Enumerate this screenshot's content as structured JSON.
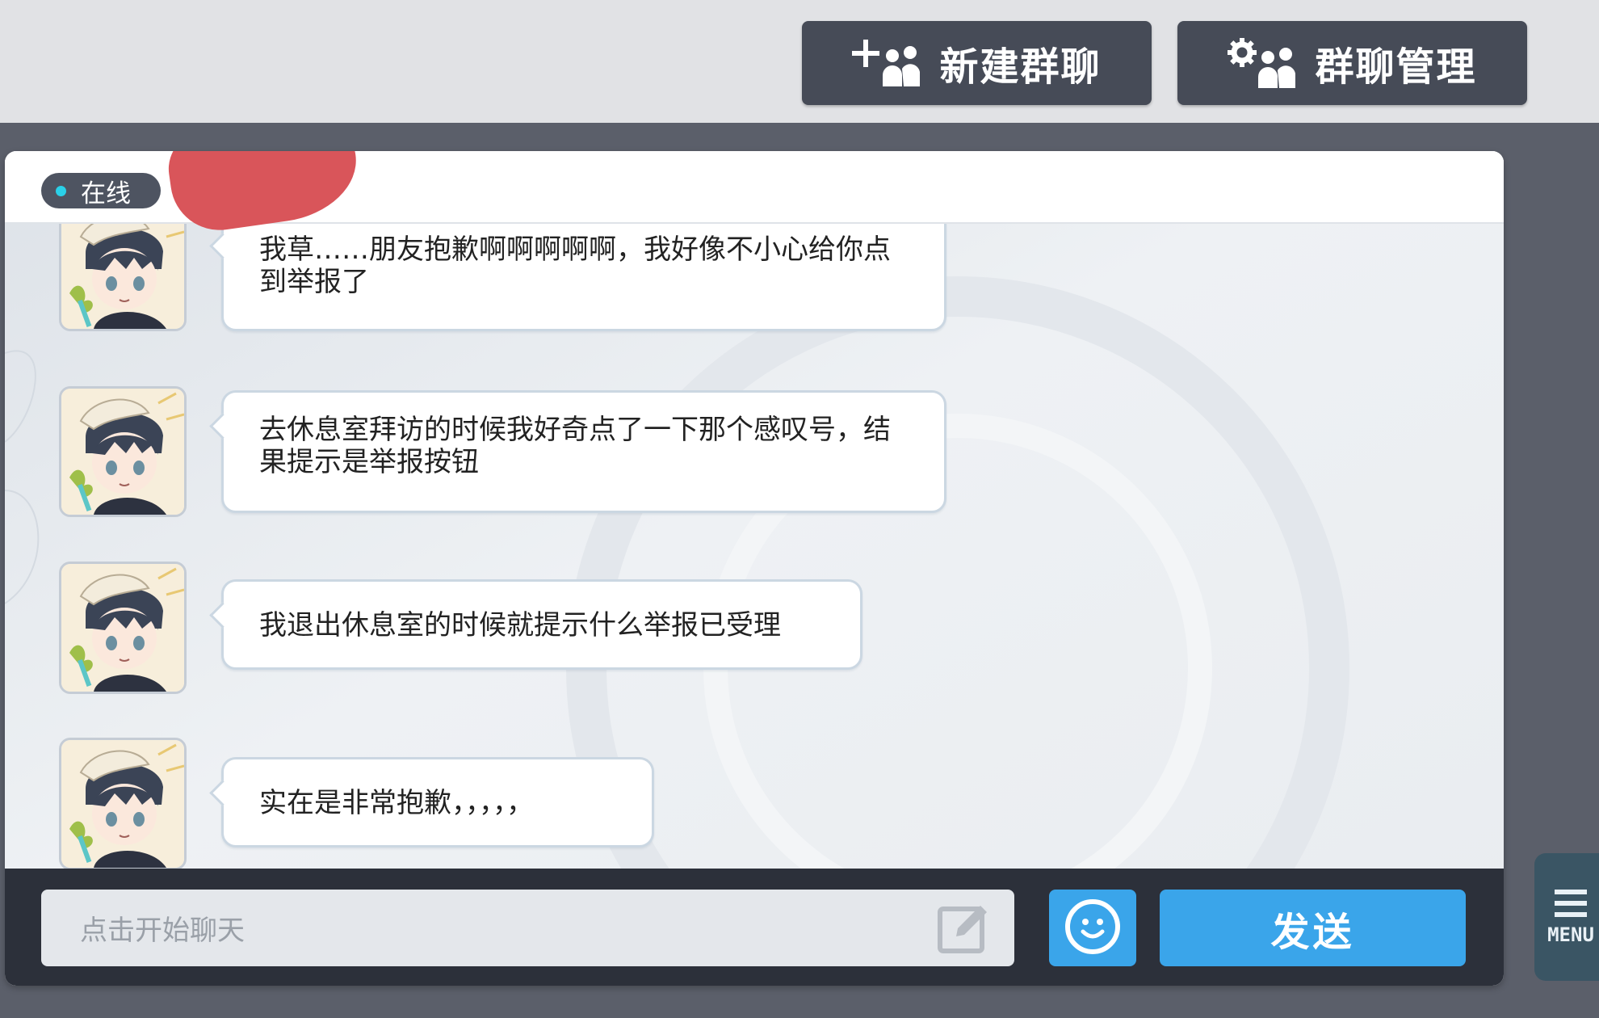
{
  "top_buttons": {
    "new_group": "新建群聊",
    "manage_group": "群聊管理"
  },
  "header": {
    "status": "在线"
  },
  "messages": [
    {
      "text": "我草……朋友抱歉啊啊啊啊啊，我好像不小心给你点到举报了"
    },
    {
      "text": "去休息室拜访的时候我好奇点了一下那个感叹号，结果提示是举报按钮"
    },
    {
      "text": "我退出休息室的时候就提示什么举报已受理"
    },
    {
      "text": "实在是非常抱歉，，，，，"
    }
  ],
  "input": {
    "placeholder": "点击开始聊天"
  },
  "send_label": "发送",
  "menu_label": "MENU",
  "icons": {
    "new_group": "add-group-icon",
    "manage_group": "group-settings-icon",
    "edit": "edit-icon",
    "emoji": "smiley-icon",
    "menu": "hamburger-icon"
  },
  "colors": {
    "accent": "#3aa5ea",
    "status_dot": "#2ad0e8",
    "button_dark": "#464b57",
    "redaction": "#d9555a"
  }
}
